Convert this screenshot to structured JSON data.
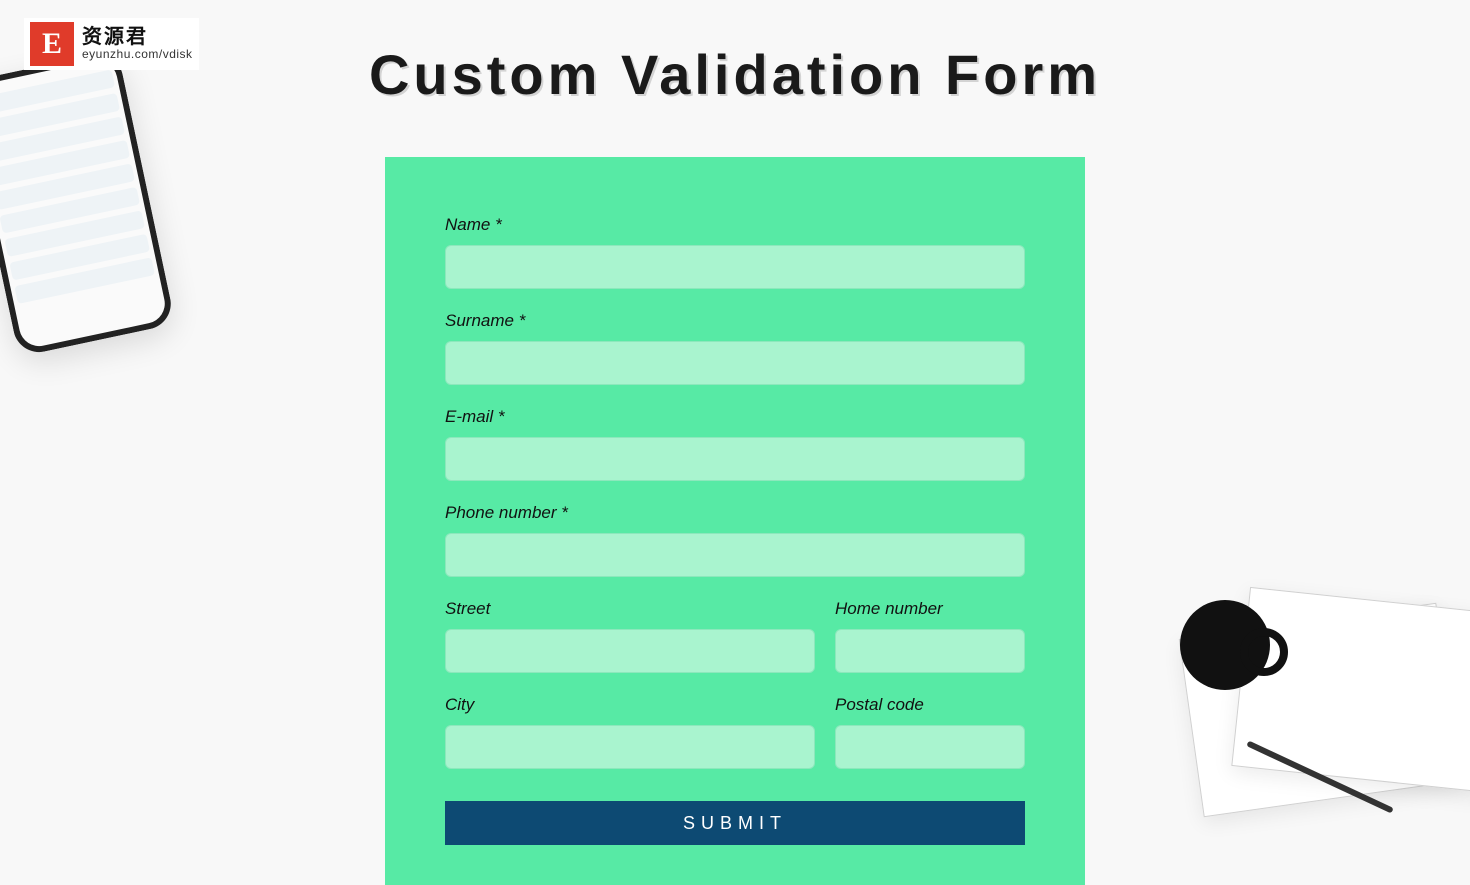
{
  "watermark": {
    "letter": "E",
    "cn": "资源君",
    "url": "eyunzhu.com/vdisk"
  },
  "page_title": "Custom Validation Form",
  "required_marker": "*",
  "form": {
    "name": {
      "label": "Name",
      "required": true,
      "value": ""
    },
    "surname": {
      "label": "Surname",
      "required": true,
      "value": ""
    },
    "email": {
      "label": "E-mail",
      "required": true,
      "value": ""
    },
    "phone": {
      "label": "Phone number",
      "required": true,
      "value": ""
    },
    "street": {
      "label": "Street",
      "required": false,
      "value": ""
    },
    "home_number": {
      "label": "Home number",
      "required": false,
      "value": ""
    },
    "city": {
      "label": "City",
      "required": false,
      "value": ""
    },
    "postal": {
      "label": "Postal code",
      "required": false,
      "value": ""
    }
  },
  "submit_label": "SUBMIT"
}
